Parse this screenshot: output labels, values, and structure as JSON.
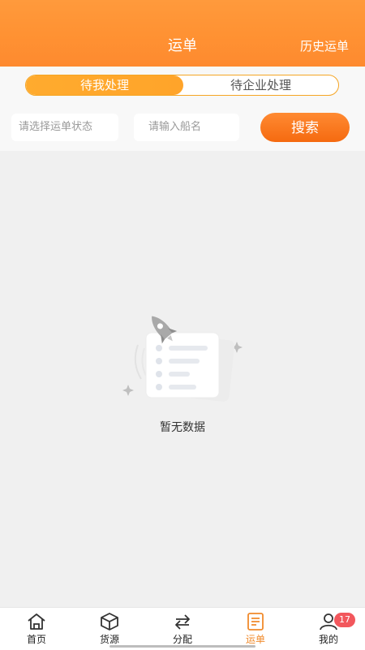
{
  "header": {
    "title": "运单",
    "history_label": "历史运单"
  },
  "tabs": [
    {
      "label": "待我处理",
      "active": true
    },
    {
      "label": "待企业处理",
      "active": false
    }
  ],
  "search": {
    "status_placeholder": "请选择运单状态",
    "ship_placeholder": "请输入船名",
    "button_label": "搜索"
  },
  "empty": {
    "text": "暂无数据",
    "icon": "empty-document-rocket-icon"
  },
  "tabbar": {
    "items": [
      {
        "label": "首页",
        "icon": "home-icon"
      },
      {
        "label": "货源",
        "icon": "box-icon"
      },
      {
        "label": "分配",
        "icon": "swap-arrows-icon"
      },
      {
        "label": "运单",
        "icon": "document-icon",
        "active": true
      },
      {
        "label": "我的",
        "icon": "user-icon",
        "badge": "17"
      }
    ]
  },
  "colors": {
    "accent": "#ff9233",
    "tab_active": "#ffa42a",
    "search_button": "#f56a10",
    "badge": "#f2575c",
    "active_tab_text": "#f08a2b"
  }
}
